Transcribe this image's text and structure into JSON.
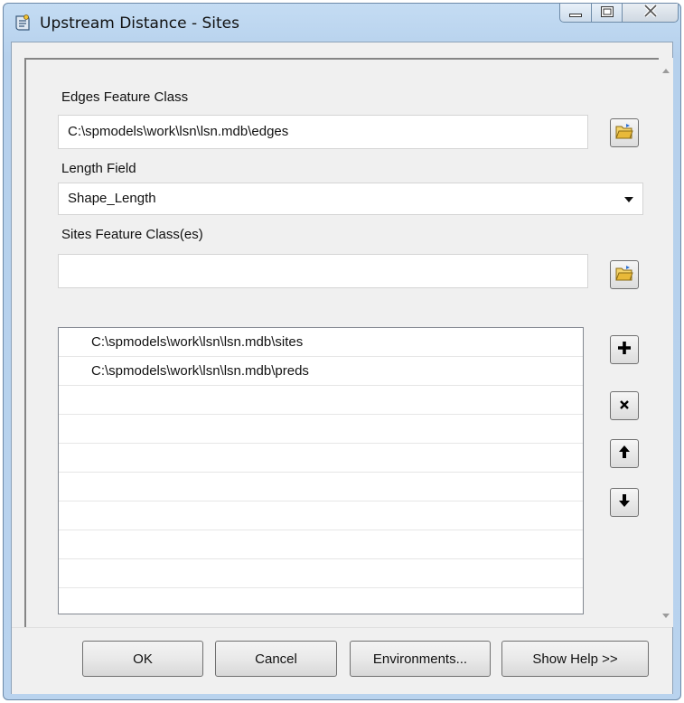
{
  "window": {
    "title": "Upstream Distance - Sites",
    "icon": "script-tool-icon",
    "controls": [
      "minimize-icon",
      "maximize-icon",
      "close-icon"
    ]
  },
  "params": {
    "edges_label": "Edges Feature Class",
    "edges_value": "C:\\spmodels\\work\\lsn\\lsn.mdb\\edges",
    "length_label": "Length Field",
    "length_value": "Shape_Length",
    "sites_label": "Sites Feature Class(es)",
    "sites_value": "",
    "sites_list": [
      "C:\\spmodels\\work\\lsn\\lsn.mdb\\sites",
      "C:\\spmodels\\work\\lsn\\lsn.mdb\\preds",
      "",
      "",
      "",
      "",
      "",
      "",
      "",
      ""
    ]
  },
  "list_tools": [
    "add-icon",
    "remove-icon",
    "move-up-icon",
    "move-down-icon"
  ],
  "footer": {
    "ok": "OK",
    "cancel": "Cancel",
    "environments": "Environments...",
    "show_help": "Show Help >>"
  },
  "colors": {
    "title_bar": "#b9d3ee",
    "folder_icon": "#e8b939"
  }
}
